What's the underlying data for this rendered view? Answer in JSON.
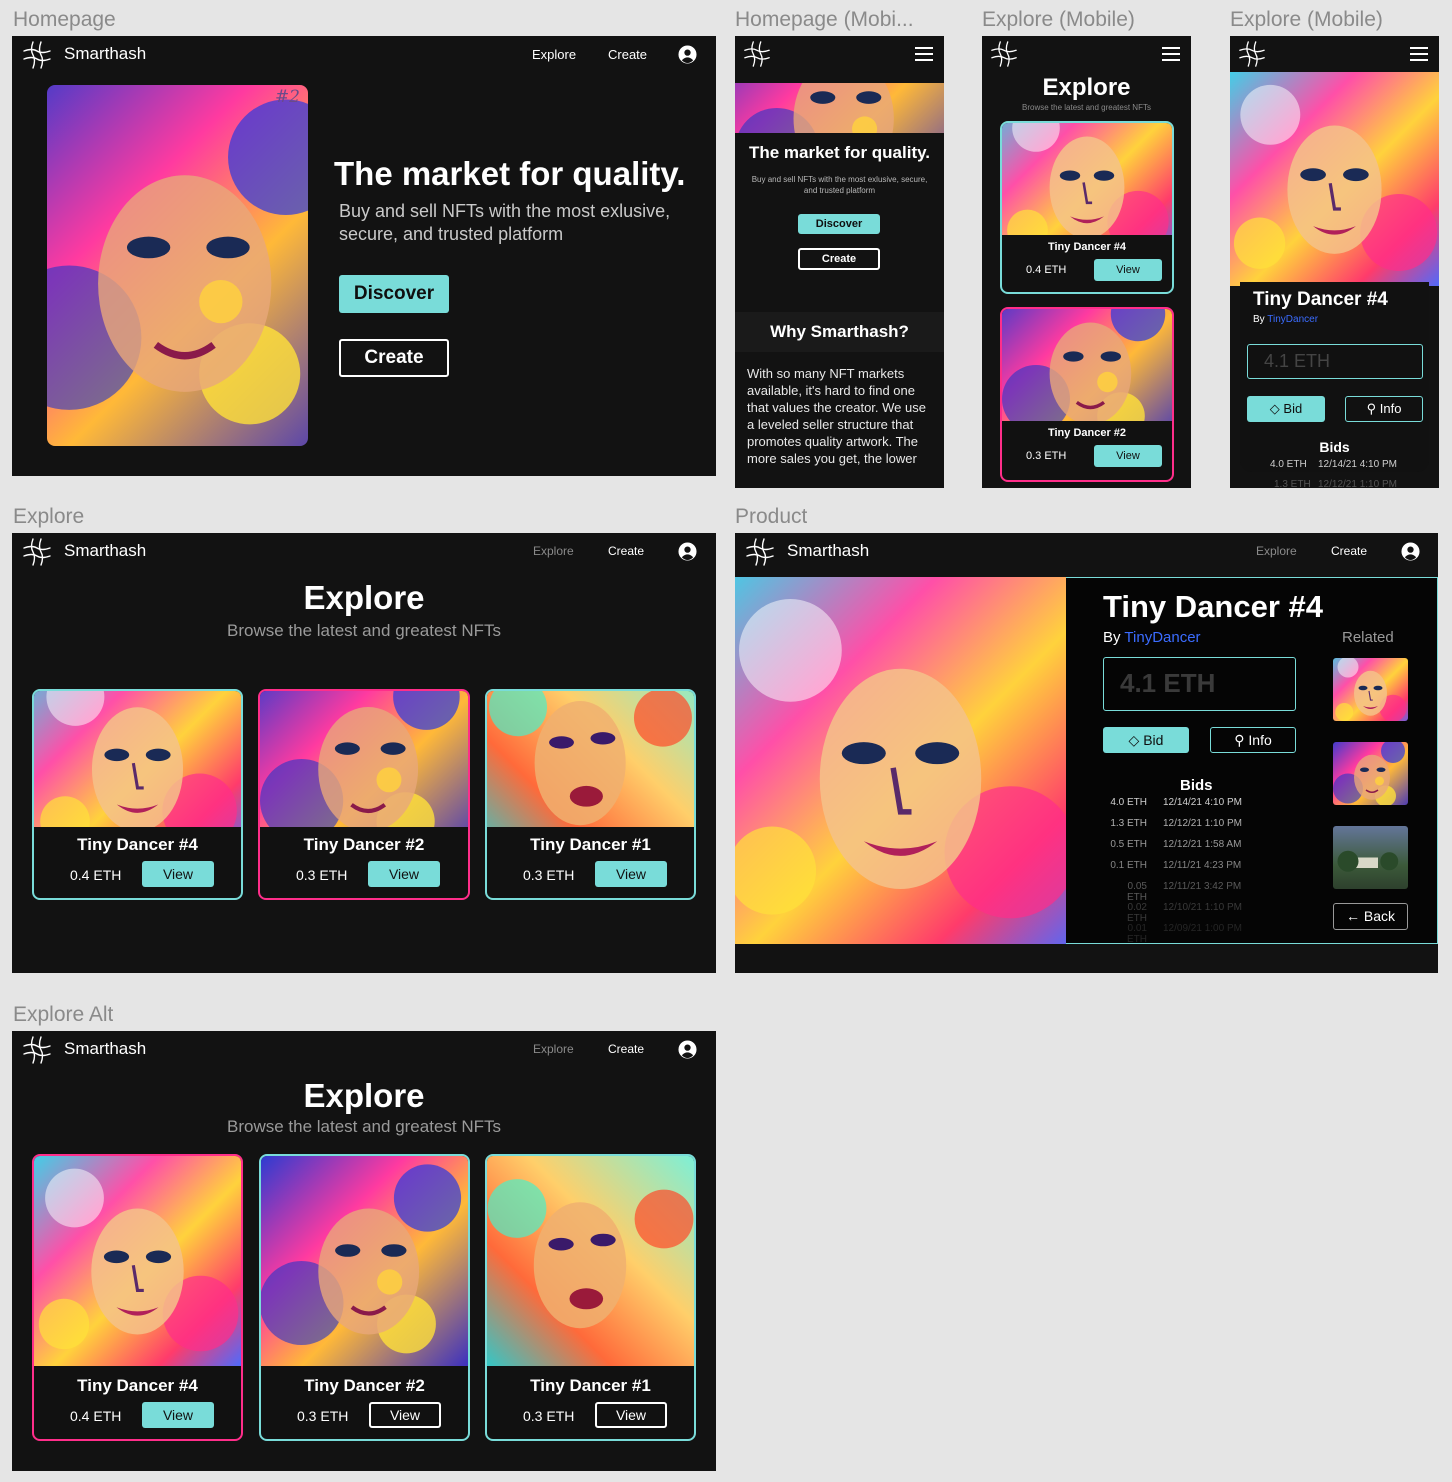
{
  "frames": {
    "homepage": "Homepage",
    "homepage_mobile": "Homepage (Mobi...",
    "explore_mobile_1": "Explore (Mobile)",
    "explore_mobile_2": "Explore (Mobile)",
    "explore": "Explore",
    "product": "Product",
    "explore_alt": "Explore Alt"
  },
  "brand": "Smarthash",
  "nav": {
    "explore": "Explore",
    "create": "Create"
  },
  "hero": {
    "title": "The market for quality.",
    "subtitle": "Buy and sell NFTs with the most exlusive, secure, and trusted platform",
    "mobile_subtitle": "Buy and sell NFTs with the most exlusive, secure, and trusted platform",
    "discover": "Discover",
    "create": "Create",
    "card_tag": "#2"
  },
  "why": {
    "title": "Why Smarthash?",
    "body": "With so many NFT markets available, it's hard to find one that values the creator. We use a leveled seller structure that promotes quality artwork. The more sales you get, the lower"
  },
  "explore": {
    "title": "Explore",
    "subtitle": "Browse the latest and greatest NFTs",
    "view": "View",
    "cards": [
      {
        "name": "Tiny Dancer #4",
        "price": "0.4 ETH"
      },
      {
        "name": "Tiny Dancer #2",
        "price": "0.3 ETH"
      },
      {
        "name": "Tiny Dancer #1",
        "price": "0.3 ETH"
      }
    ]
  },
  "product": {
    "title": "Tiny Dancer #4",
    "by": "By",
    "author": "TinyDancer",
    "price_placeholder": "4.1 ETH",
    "bid": "Bid",
    "info": "Info",
    "bids_title": "Bids",
    "related": "Related",
    "back": "Back",
    "bids": [
      {
        "amount": "4.0 ETH",
        "date": "12/14/21 4:10 PM"
      },
      {
        "amount": "1.3 ETH",
        "date": "12/12/21 1:10 PM"
      },
      {
        "amount": "0.5 ETH",
        "date": "12/12/21 1:58 AM"
      },
      {
        "amount": "0.1 ETH",
        "date": "12/11/21 4:23 PM"
      },
      {
        "amount": "0.05 ETH",
        "date": "12/11/21 3:42 PM"
      },
      {
        "amount": "0.02 ETH",
        "date": "12/10/21 1:10 PM"
      },
      {
        "amount": "0.01 ETH",
        "date": "12/09/21 1:00 PM"
      }
    ],
    "mobile_bids": [
      {
        "amount": "4.0 ETH",
        "date": "12/14/21 4:10 PM"
      },
      {
        "amount": "1.3 ETH",
        "date": "12/12/21 1:10 PM"
      }
    ]
  },
  "colors": {
    "accent": "#79dcd9",
    "link": "#3b6cff",
    "bg": "#121212",
    "pink": "#ff2e8a"
  }
}
